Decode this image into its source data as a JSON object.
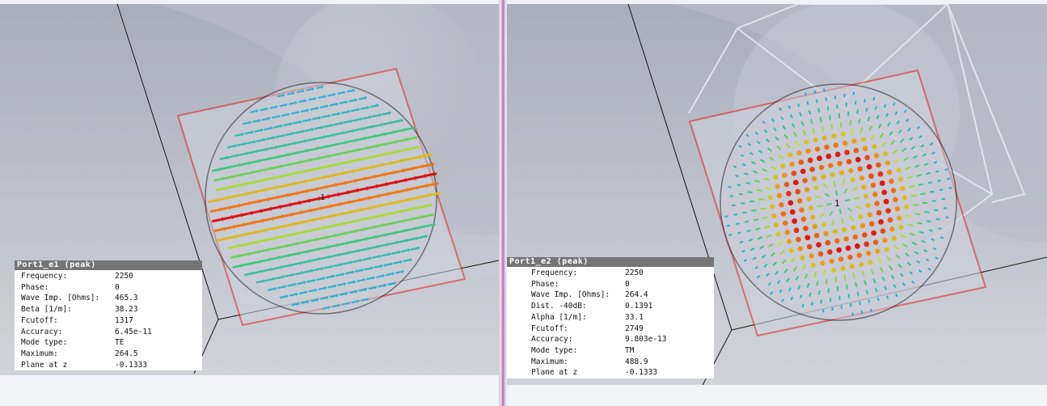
{
  "views": [
    {
      "id": "left",
      "info_title": "Port1_e1 (peak)",
      "rows": [
        {
          "key": "Frequency:",
          "value": "2250"
        },
        {
          "key": "Phase:",
          "value": "0"
        },
        {
          "key": "Wave Imp. [Ohms]:",
          "value": "465.3"
        },
        {
          "key": "Beta [1/m]:",
          "value": "38.23"
        },
        {
          "key": "Fcutoff:",
          "value": "1317"
        },
        {
          "key": "Accuracy:",
          "value": "6.45e-11"
        },
        {
          "key": "Mode type:",
          "value": "TE"
        },
        {
          "key": "Maximum:",
          "value": "264.5"
        },
        {
          "key": "Plane at z",
          "value": "-0.1333"
        }
      ],
      "port_label": "1"
    },
    {
      "id": "right",
      "info_title": "Port1_e2 (peak)",
      "rows": [
        {
          "key": "Frequency:",
          "value": "2250"
        },
        {
          "key": "Phase:",
          "value": "0"
        },
        {
          "key": "Wave Imp. [Ohms]:",
          "value": "264.4"
        },
        {
          "key": "Dist. -40dB:",
          "value": "0.1391"
        },
        {
          "key": "Alpha [1/m]:",
          "value": "33.1"
        },
        {
          "key": "Fcutoff:",
          "value": "2749"
        },
        {
          "key": "Accuracy:",
          "value": "9.803e-13"
        },
        {
          "key": "Mode type:",
          "value": "TM"
        },
        {
          "key": "Maximum:",
          "value": "488.9"
        },
        {
          "key": "Plane at z",
          "value": "-0.1333"
        }
      ],
      "port_label": "1"
    }
  ],
  "colors": {
    "port_frame": "#e02020",
    "circle_outline": "#111111",
    "title_bar": "#757575",
    "splitter": "#c070c0"
  }
}
